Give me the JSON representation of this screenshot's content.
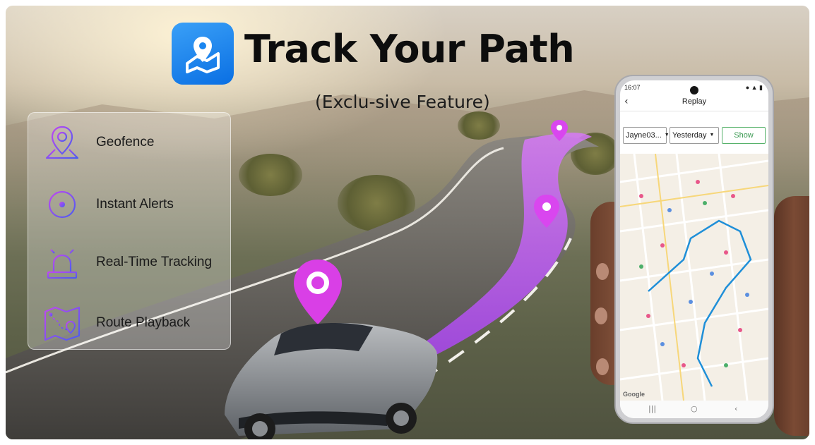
{
  "header": {
    "title": "Track Your Path",
    "subtitle": "(Exclu-sive Feature)",
    "app_icon": "map-pin-icon"
  },
  "features": [
    {
      "label": "Geofence",
      "icon": "geofence-pin-icon"
    },
    {
      "label": "Instant Alerts",
      "icon": "crosshair-icon"
    },
    {
      "label": "Real-Time Tracking",
      "icon": "alarm-light-icon"
    },
    {
      "label": "Route Playback",
      "icon": "route-map-icon"
    }
  ],
  "phone": {
    "status_time": "16:07",
    "screen_title": "Replay",
    "vehicle_select": "Jayne03...",
    "date_select": "Yesterday",
    "show_button": "Show",
    "map_attribution": "Google"
  },
  "colors": {
    "accent_purple": "#b24bf3",
    "pin_magenta": "#e03ee8",
    "app_icon_blue": "#1a86f0",
    "route_blue": "#1f8fd8",
    "show_green": "#3b9a52"
  }
}
